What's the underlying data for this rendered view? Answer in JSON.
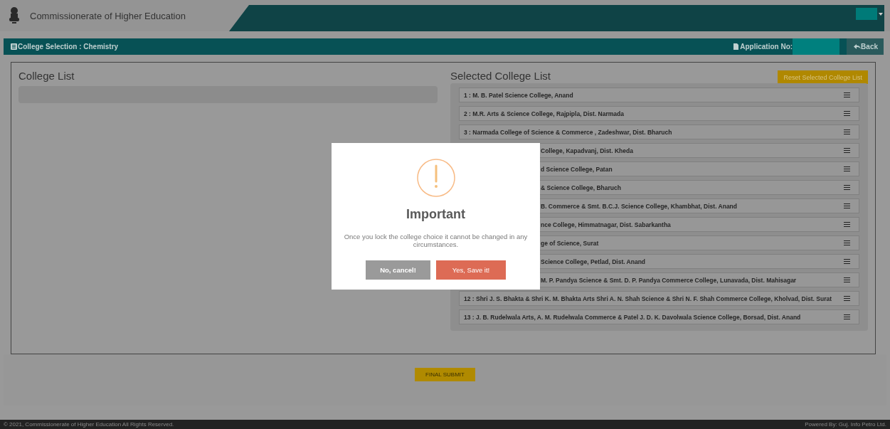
{
  "header": {
    "title": "Commissionerate of Higher Education"
  },
  "nav_bar": {
    "title": "College Selection : Chemistry",
    "application_label": "Application No:",
    "back": "Back"
  },
  "college_list": {
    "heading": "College List"
  },
  "selected_list": {
    "heading": "Selected College List",
    "reset_button": "Reset Selected College List",
    "items": [
      {
        "kind": "full",
        "text": "1 : M. B. Patel Science College, Anand"
      },
      {
        "kind": "full",
        "text": "2 : M.R. Arts & Science College, Rajpipla, Dist. Narmada"
      },
      {
        "kind": "full",
        "text": "3 : Narmada College of Science & Commerce , Zadeshwar, Dist. Bharuch"
      },
      {
        "kind": "covered",
        "text": "College, Kapadvanj, Dist. Kheda"
      },
      {
        "kind": "covered",
        "text": "d Science College, Patan"
      },
      {
        "kind": "covered",
        "text": "& Science College, Bharuch"
      },
      {
        "kind": "covered",
        "text": "B. Commerce & Smt. B.C.J. Science College, Khambhat, Dist. Anand"
      },
      {
        "kind": "covered",
        "text": "nce College, Himmatnagar, Dist. Sabarkantha"
      },
      {
        "kind": "covered",
        "text": "ge of Science, Surat"
      },
      {
        "kind": "covered",
        "text": "Science College, Petlad, Dist. Anand"
      },
      {
        "kind": "covered",
        "text": "M. P. Pandya Science & Smt. D. P. Pandya Commerce College, Lunavada, Dist. Mahisagar"
      },
      {
        "kind": "full",
        "text": "12 : Shri J. S. Bhakta & Shri K. M. Bhakta Arts Shri A. N. Shah Science & Shri N. F. Shah Commerce College, Kholvad, Dist. Surat"
      },
      {
        "kind": "full",
        "text": "13 : J. B. Rudelwala Arts, A. M. Rudelwala Commerce & Patel J. D. K. Davolwala Science College, Borsad, Dist. Anand"
      }
    ]
  },
  "final_submit": "FINAL SUBMIT",
  "dialog": {
    "title": "Important",
    "message": "Once you lock the college choice it cannot be changed in any circumstances.",
    "buttons": [
      {
        "kind": "cancel",
        "label": "No, cancel!"
      },
      {
        "kind": "confirm",
        "label": "Yes, Save it!"
      }
    ]
  },
  "footer": {
    "copyright": "© 2021, Commissionerate of Higher Education All Rights Reserved.",
    "powered_by": "Powered By: Guj. Info Petro Ltd."
  }
}
